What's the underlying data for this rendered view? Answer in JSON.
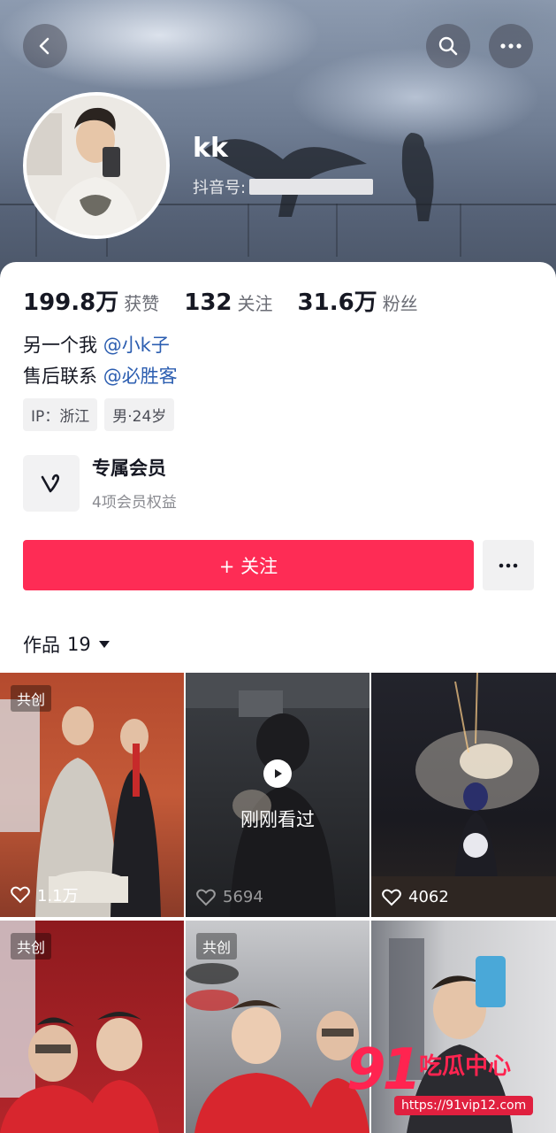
{
  "header": {
    "name": "kk",
    "uid_label": "抖音号:"
  },
  "stats": [
    {
      "value": "199.8万",
      "label": "获赞"
    },
    {
      "value": "132",
      "label": "关注"
    },
    {
      "value": "31.6万",
      "label": "粉丝"
    }
  ],
  "bio": {
    "line1_text": "另一个我",
    "line1_mention": "@小k子",
    "line2_text": "售后联系",
    "line2_mention": "@必胜客"
  },
  "tags": [
    "IP：浙江",
    "男·24岁"
  ],
  "membership": {
    "title": "专属会员",
    "subtitle": "4项会员权益"
  },
  "actions": {
    "follow_label": "+ 关注"
  },
  "works": {
    "label": "作品",
    "count": "19"
  },
  "grid": [
    {
      "badge": "共创",
      "likes": "1.1万"
    },
    {
      "overlay": "刚刚看过",
      "likes": "5694"
    },
    {
      "likes": "4062"
    },
    {
      "badge": "共创"
    },
    {
      "badge": "共创"
    },
    {}
  ],
  "watermark": {
    "big": "91",
    "cn": "吃瓜中心",
    "url": "https://91vip12.com"
  },
  "colors": {
    "follow": "#fe2c55",
    "mention": "#2b5db0"
  },
  "icons": [
    "back-icon",
    "search-icon",
    "more-icon",
    "member-v-icon",
    "more-dots-icon",
    "dropdown-triangle-icon",
    "heart-icon",
    "play-icon"
  ]
}
